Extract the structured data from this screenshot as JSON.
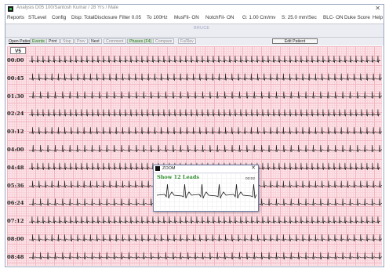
{
  "window": {
    "title": "Analysis  D05  100/Santosh Kumar / 28 Yrs / Male",
    "close_glyph": "✕"
  },
  "menu": [
    {
      "label": "Reports"
    },
    {
      "label": "STLevel"
    },
    {
      "label": "Config"
    },
    {
      "label": "Disp: TotalDisclosure"
    },
    {
      "label": "Filter 0.05"
    },
    {
      "label": "To 100Hz"
    },
    {
      "label": "MusFil- ON"
    },
    {
      "label": "NotchFil- ON"
    },
    {
      "label": "G: 1.00 Cm/mv"
    },
    {
      "label": "S: 25.0 mm/Sec"
    },
    {
      "label": "BLC- ON"
    },
    {
      "label": "Duke Score"
    },
    {
      "label": "Help"
    }
  ],
  "patient_label": "BRUCE",
  "toolbar": {
    "open_patient": "Open Patient",
    "events": "Events",
    "print": "Print",
    "stop": "Stop",
    "prev": "Prev",
    "next": "Next",
    "comment": "Comment",
    "phases": "Phases (F4)",
    "compare": "Compare",
    "fu_rev": "Fu/Rev",
    "edit_patient": "Edit Patient"
  },
  "lead": "V5",
  "strips": [
    {
      "time": "00:00"
    },
    {
      "time": "00:45"
    },
    {
      "time": "01:30"
    },
    {
      "time": "02:24"
    },
    {
      "time": "03:12"
    },
    {
      "time": "04:00"
    },
    {
      "time": "04:48"
    },
    {
      "time": "05:36"
    },
    {
      "time": "06:24"
    },
    {
      "time": "07:12"
    },
    {
      "time": "08:00"
    },
    {
      "time": "08:48"
    }
  ],
  "zoom": {
    "title": "ZOOM",
    "close_glyph": "✕",
    "show_12_leads": "Show 12 Leads",
    "time": "03:02"
  },
  "colors": {
    "grid_major": "#f3b6c1",
    "grid_minor": "#f9d3da",
    "trace": "#1e1e1e",
    "accent_green": "#2f8f2f"
  }
}
